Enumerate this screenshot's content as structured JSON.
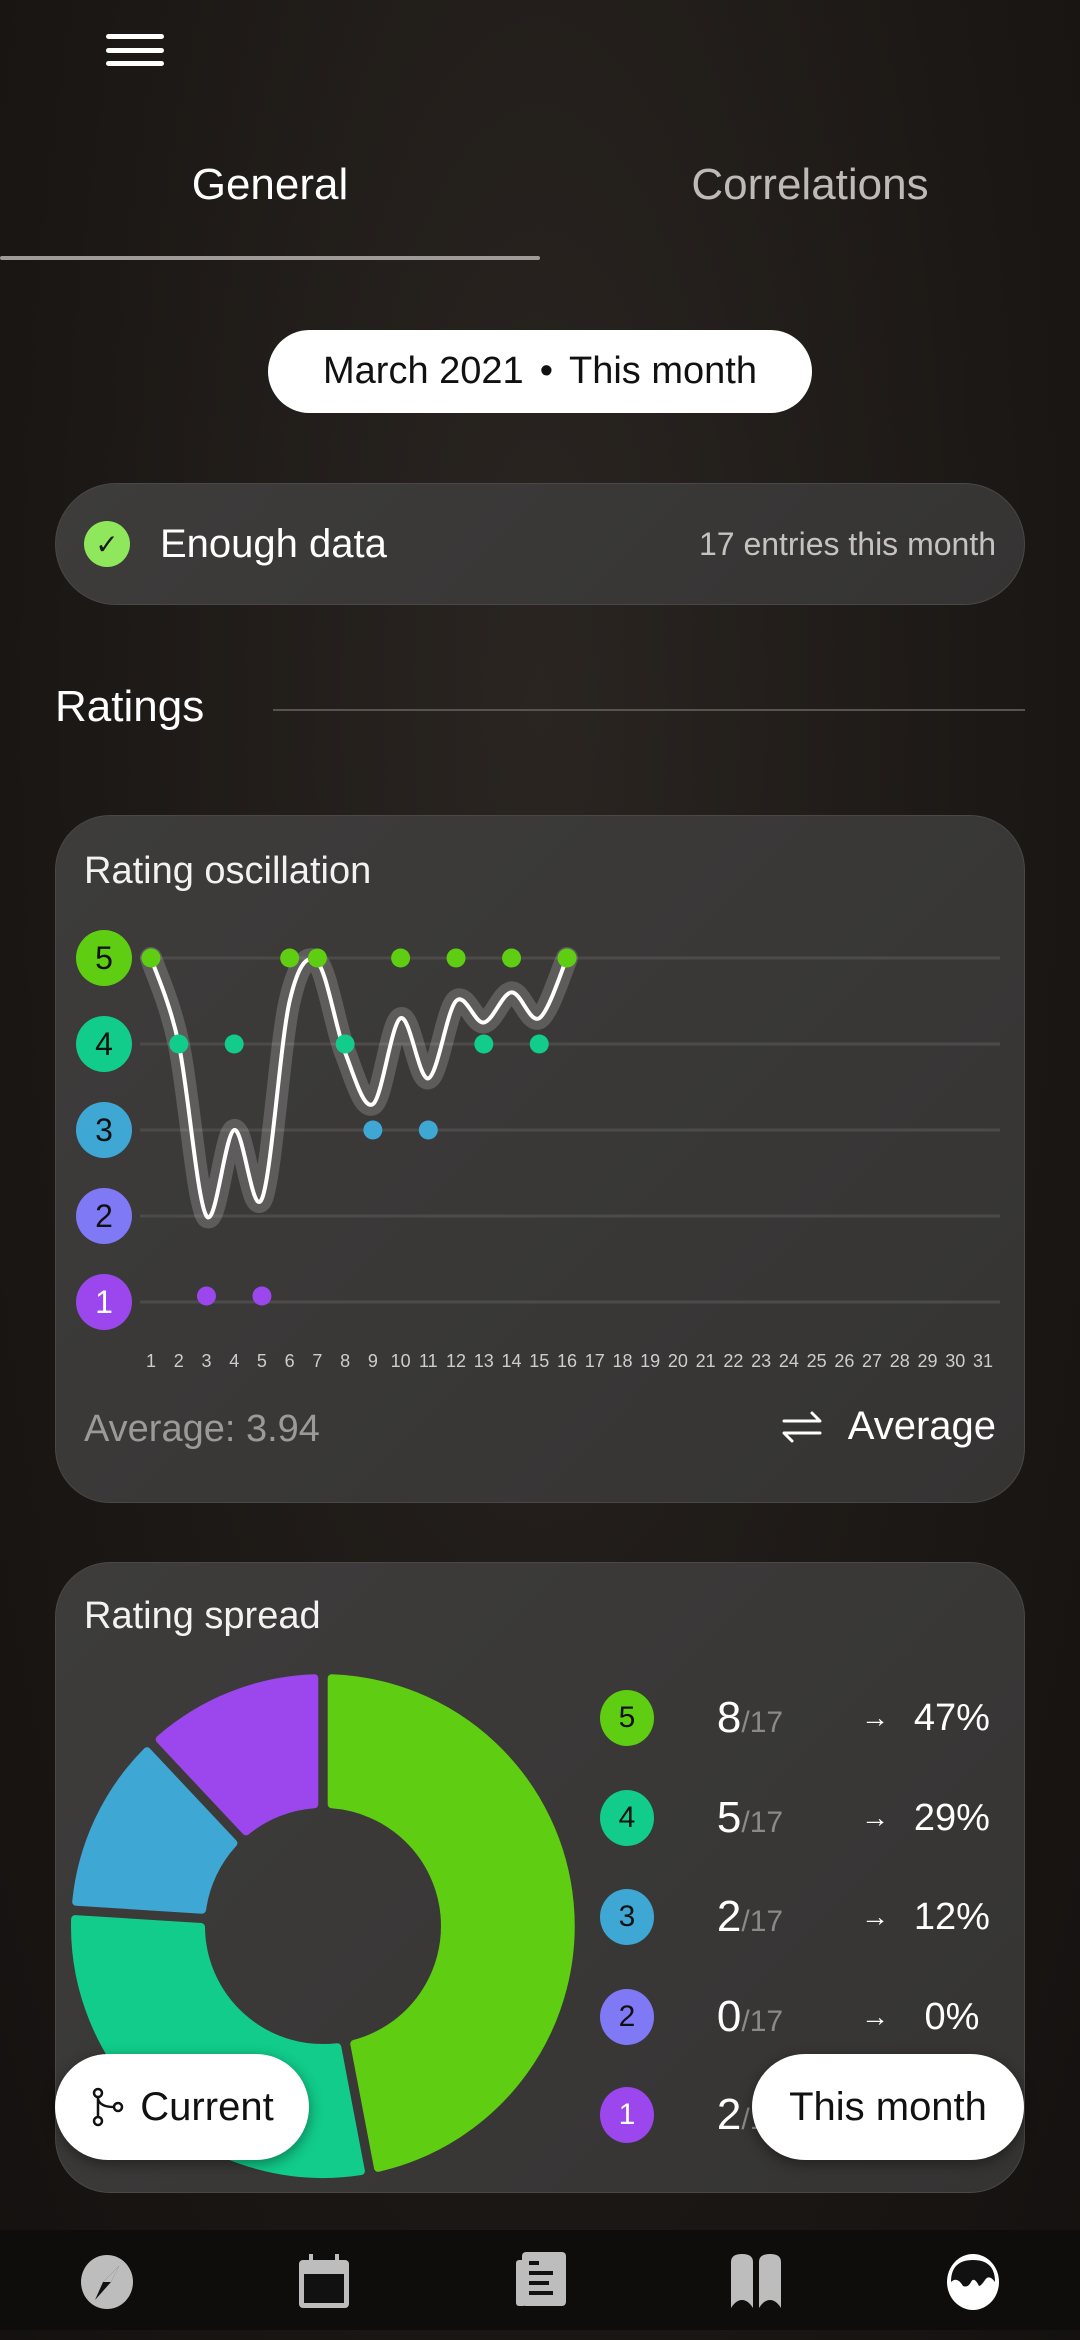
{
  "header": {
    "menu_icon": "hamburger-icon"
  },
  "tabs": [
    {
      "label": "General",
      "active": true
    },
    {
      "label": "Correlations",
      "active": false
    }
  ],
  "period": {
    "month": "March  2021",
    "separator": "•",
    "range": "This month"
  },
  "status": {
    "icon": "check-circle-icon",
    "label": "Enough data",
    "entries": "17 entries this month",
    "color": "#8fe85b"
  },
  "section": {
    "title": "Ratings"
  },
  "colors": {
    "5": "#5fcd12",
    "4": "#11cc8a",
    "3": "#3ea7d4",
    "2": "#7f79f5",
    "1": "#9c47ee"
  },
  "oscillation": {
    "title": "Rating oscillation",
    "average_text": "Average: 3.94",
    "toggle_icon": "swap-arrows-icon",
    "toggle_label": "Average"
  },
  "spread": {
    "title": "Rating spread",
    "rows": [
      {
        "rating": "5",
        "count": "8",
        "total": "/17",
        "arrow": "→",
        "pct": "47%"
      },
      {
        "rating": "4",
        "count": "5",
        "total": "/17",
        "arrow": "→",
        "pct": "29%"
      },
      {
        "rating": "3",
        "count": "2",
        "total": "/17",
        "arrow": "→",
        "pct": "12%"
      },
      {
        "rating": "2",
        "count": "0",
        "total": "/17",
        "arrow": "→",
        "pct": "0%"
      },
      {
        "rating": "1",
        "count": "2",
        "total": "/17",
        "arrow": "→",
        "pct": "12%"
      }
    ]
  },
  "buttons": {
    "current_icon": "branch-icon",
    "current": "Current",
    "this_month": "This month"
  },
  "nav": [
    {
      "icon": "compass-icon"
    },
    {
      "icon": "calendar-icon"
    },
    {
      "icon": "journal-icon"
    },
    {
      "icon": "book-icon"
    },
    {
      "icon": "stats-icon",
      "active": true
    }
  ],
  "chart_data": [
    {
      "type": "scatter",
      "title": "Rating oscillation",
      "x": [
        1,
        2,
        3,
        4,
        5,
        6,
        7,
        8,
        9,
        10,
        11,
        12,
        13,
        14,
        15,
        16
      ],
      "ratings": [
        5,
        4,
        1,
        4,
        1,
        5,
        5,
        4,
        3,
        5,
        3,
        5,
        4,
        5,
        4,
        5
      ],
      "trend_line": [
        5,
        4,
        2,
        3,
        2.2,
        4.5,
        4.95,
        3.9,
        3.3,
        4.3,
        3.6,
        4.5,
        4.25,
        4.6,
        4.3,
        5
      ],
      "x_ticks": [
        "1",
        "2",
        "3",
        "4",
        "5",
        "6",
        "7",
        "8",
        "9",
        "10",
        "11",
        "12",
        "13",
        "14",
        "15",
        "16",
        "17",
        "18",
        "19",
        "20",
        "21",
        "22",
        "23",
        "24",
        "25",
        "26",
        "27",
        "28",
        "29",
        "30",
        "31"
      ],
      "y_ticks": [
        "5",
        "4",
        "3",
        "2",
        "1"
      ],
      "xlim": [
        1,
        31
      ],
      "ylim": [
        1,
        5
      ],
      "grid": true
    },
    {
      "type": "pie",
      "title": "Rating spread",
      "categories": [
        "5",
        "4",
        "3",
        "2",
        "1"
      ],
      "values": [
        47,
        29,
        12,
        0,
        12
      ],
      "donut": true
    }
  ]
}
